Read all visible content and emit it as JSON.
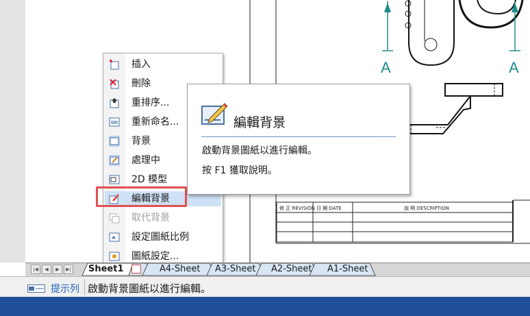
{
  "context_menu": {
    "items": [
      {
        "label": "插入",
        "icon": "insert-sheet-icon"
      },
      {
        "label": "刪除",
        "icon": "delete-sheet-icon"
      },
      {
        "label": "重排序...",
        "icon": "reorder-icon"
      },
      {
        "label": "重新命名...",
        "icon": "rename-icon"
      },
      {
        "label": "背景",
        "icon": "background-icon"
      },
      {
        "label": "處理中",
        "icon": "working-icon"
      },
      {
        "label": "2D 模型",
        "icon": "2d-model-icon"
      },
      {
        "label": "編輯背景",
        "icon": "edit-background-icon"
      },
      {
        "label": "取代背景",
        "icon": "replace-background-icon"
      },
      {
        "label": "設定圖紙比例",
        "icon": "sheet-scale-icon"
      },
      {
        "label": "圖紙設定...",
        "icon": "sheet-setup-icon"
      }
    ]
  },
  "tooltip": {
    "title": "編輯背景",
    "description": "啟動背景圖紙以進行編輯。",
    "help": "按 F1 獲取說明。"
  },
  "sheet_tabs": {
    "tabs": [
      "Sheet1",
      "A4-Sheet",
      "A3-Sheet",
      "A2-Sheet",
      "A1-Sheet"
    ],
    "active": "Sheet1"
  },
  "drawing": {
    "section_label_left": "A",
    "section_label_right": "A",
    "revision_headers": [
      "修 正 REVISION",
      "日 期  DATE",
      "說 明  DESCRIPTION"
    ]
  },
  "status_bar": {
    "prefix": "提示列",
    "message": "啟動背景圖紙以進行編輯。"
  },
  "colors": {
    "accent_teal": "#1f8c8c",
    "highlight_box": "#e05050",
    "menu_highlight": "#cfe1f5",
    "taskbar": "#1f4f96"
  }
}
